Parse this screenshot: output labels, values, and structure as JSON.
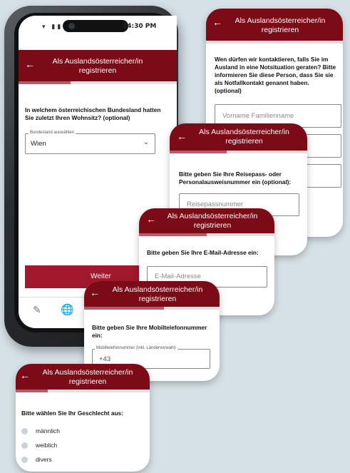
{
  "phone": {
    "status_time": "14:30 PM",
    "header_title": "Als Auslandsösterreicher/in registrieren",
    "progress": 0.33,
    "question": "In welchem österreichischen Bundesland hatten Sie zuletzt Ihren Wohnsitz? (optional)",
    "select_label": "Bundesland auswählen",
    "select_value": "Wien",
    "next_button": "Weiter"
  },
  "cards": {
    "emergency": {
      "header_title": "Als Auslandsösterreicher/in registrieren",
      "question": "Wen dürfen wir kontaktieren, falls Sie im Ausland in eine Notsituation geraten? Bitte informieren Sie diese Person, dass Sie sie als Notfallkontakt genannt haben. (optional)",
      "name_placeholder": "Vorname Familienname"
    },
    "passport": {
      "header_title": "Als Auslandsösterreicher/in registrieren",
      "question": "Bitte geben Sie Ihre Reisepass- oder Personalausweisnummer ein (optional):",
      "placeholder": "Reisepassnummer"
    },
    "email": {
      "header_title": "Als Auslandsösterreicher/in registrieren",
      "question": "Bitte geben Sie Ihre E-Mail-Adresse ein:",
      "placeholder": "E-Mail-Adresse"
    },
    "mobile": {
      "header_title": "Als Auslandsösterreicher/in registrieren",
      "question": "Bitte geben Sie Ihre Mobiltelefonnummer ein:",
      "field_label": "Mobiltelefonnummer (inkl. Ländervorwahl)",
      "field_value": "+43"
    },
    "gender": {
      "header_title": "Als Auslandsösterreicher/in registrieren",
      "question": "Bitte wählen Sie Ihr Geschlecht aus:",
      "options": [
        "männlich",
        "weiblich",
        "divers"
      ]
    }
  },
  "colors": {
    "brand": "#7b0b17",
    "button": "#a3192c",
    "progress": "#b85a68",
    "background": "#d6e1e7"
  },
  "icons": {
    "back": "arrow-left-icon",
    "chevron": "chevron-down-icon",
    "nav1": "document-edit-icon",
    "nav2": "globe-icon"
  }
}
